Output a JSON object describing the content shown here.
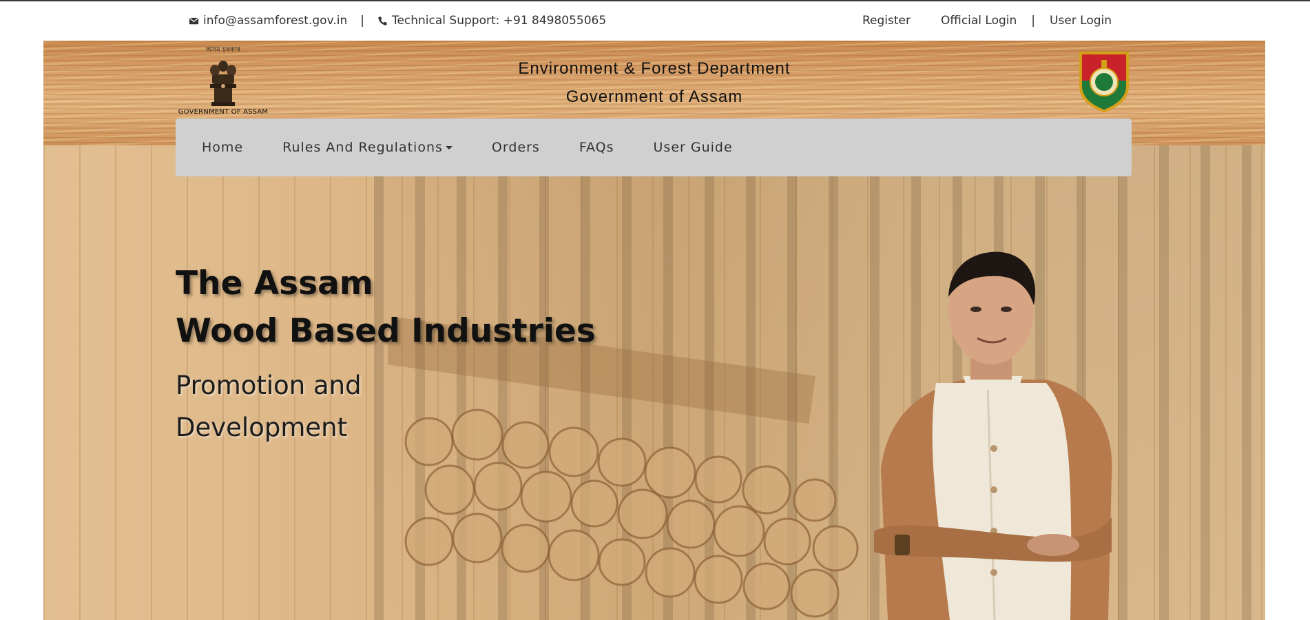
{
  "topbar": {
    "email_icon": "mail-icon",
    "email": "info@assamforest.gov.in",
    "separator": "|",
    "phone_icon": "phone-icon",
    "support": "Technical Support: +91 8498055065",
    "register": "Register",
    "official_login": "Official Login",
    "user_login": "User Login"
  },
  "header": {
    "emblem_script": "অসম চৰকাৰ",
    "emblem_caption": "GOVERNMENT OF ASSAM",
    "department": "Environment & Forest Department",
    "government": "Government of Assam",
    "badge_icon": "forest-department-badge-icon"
  },
  "nav": {
    "items": [
      {
        "label": "Home"
      },
      {
        "label": "Rules And Regulations",
        "dropdown": true
      },
      {
        "label": "Orders"
      },
      {
        "label": "FAQs"
      },
      {
        "label": "User Guide"
      }
    ]
  },
  "hero": {
    "title_line1": "The Assam",
    "title_line2": "Wood Based Industries",
    "subtitle_line1": "Promotion and",
    "subtitle_line2": "Development"
  },
  "colors": {
    "nav_bg": "#d0d0d0",
    "wood": "#d9a06a",
    "badge_red": "#c8232b",
    "badge_green": "#1f7a3a"
  }
}
